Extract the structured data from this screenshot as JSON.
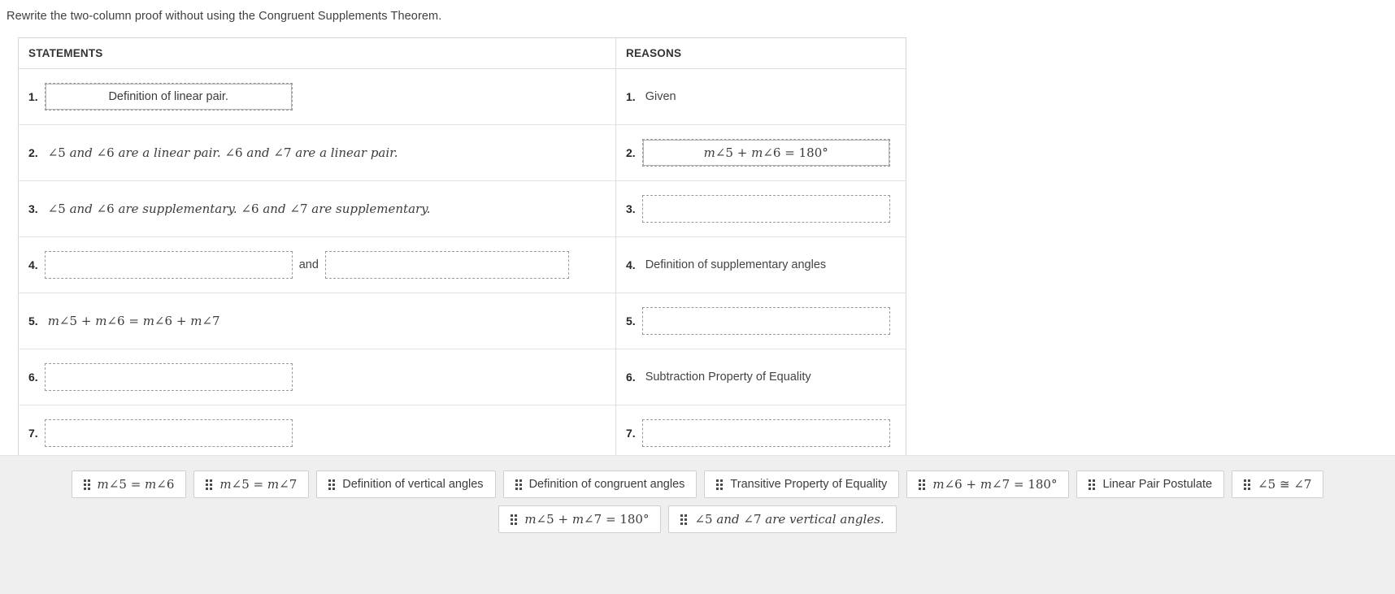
{
  "prompt": "Rewrite the two-column proof without using the Congruent Supplements Theorem.",
  "table": {
    "headers": {
      "statements": "STATEMENTS",
      "reasons": "REASONS"
    },
    "rows": [
      {
        "num": "1.",
        "statement": {
          "kind": "dropzone-filled",
          "value": "Definition of linear pair."
        },
        "reason": {
          "kind": "text",
          "value": "Given"
        }
      },
      {
        "num": "2.",
        "statement": {
          "kind": "text",
          "value": "∠5 and ∠6 are a linear pair. ∠6 and  ∠7 are a linear pair."
        },
        "reason": {
          "kind": "dropzone-filled",
          "value": "m∠5 + m∠6 = 180°"
        }
      },
      {
        "num": "3.",
        "statement": {
          "kind": "text",
          "value": "∠5 and ∠6 are supplementary.  ∠6 and ∠7 are supplementary."
        },
        "reason": {
          "kind": "dropzone-empty",
          "value": ""
        }
      },
      {
        "num": "4.",
        "statement": {
          "kind": "dropzone-pair",
          "value": "",
          "value2": "",
          "joiner": "and"
        },
        "reason": {
          "kind": "text",
          "value": "Definition of supplementary angles"
        }
      },
      {
        "num": "5.",
        "statement": {
          "kind": "math",
          "value": "m∠5 + m∠6 = m∠6 + m∠7"
        },
        "reason": {
          "kind": "dropzone-empty",
          "value": ""
        }
      },
      {
        "num": "6.",
        "statement": {
          "kind": "dropzone-empty",
          "value": ""
        },
        "reason": {
          "kind": "text",
          "value": "Subtraction Property of Equality"
        }
      },
      {
        "num": "7.",
        "statement": {
          "kind": "dropzone-empty",
          "value": ""
        },
        "reason": {
          "kind": "dropzone-empty",
          "value": ""
        }
      }
    ]
  },
  "tray": {
    "grip_icon": "drag-handle-icon",
    "rows": [
      [
        {
          "label": "m∠5 = m∠6",
          "style": "math"
        },
        {
          "label": "m∠5 = m∠7",
          "style": "math"
        },
        {
          "label": "Definition of vertical angles",
          "style": "text"
        },
        {
          "label": "Definition of congruent angles",
          "style": "text"
        },
        {
          "label": "Transitive Property of Equality",
          "style": "text"
        },
        {
          "label": "m∠6 + m∠7 = 180°",
          "style": "math"
        },
        {
          "label": "Linear Pair Postulate",
          "style": "text"
        },
        {
          "label": "∠5 ≅ ∠7",
          "style": "math"
        }
      ],
      [
        {
          "label": "m∠5 + m∠7 = 180°",
          "style": "math"
        },
        {
          "label": "∠5 and  ∠7  are vertical angles.",
          "style": "text"
        }
      ]
    ]
  },
  "colors": {
    "page_bg": "#ffffff",
    "tray_bg": "#efefef",
    "table_border": "#d6d6d6",
    "row_border": "#e2e2e2",
    "dropzone_border": "#9a9a9a",
    "chip_border": "#cfcfcf",
    "text": "#404040"
  }
}
